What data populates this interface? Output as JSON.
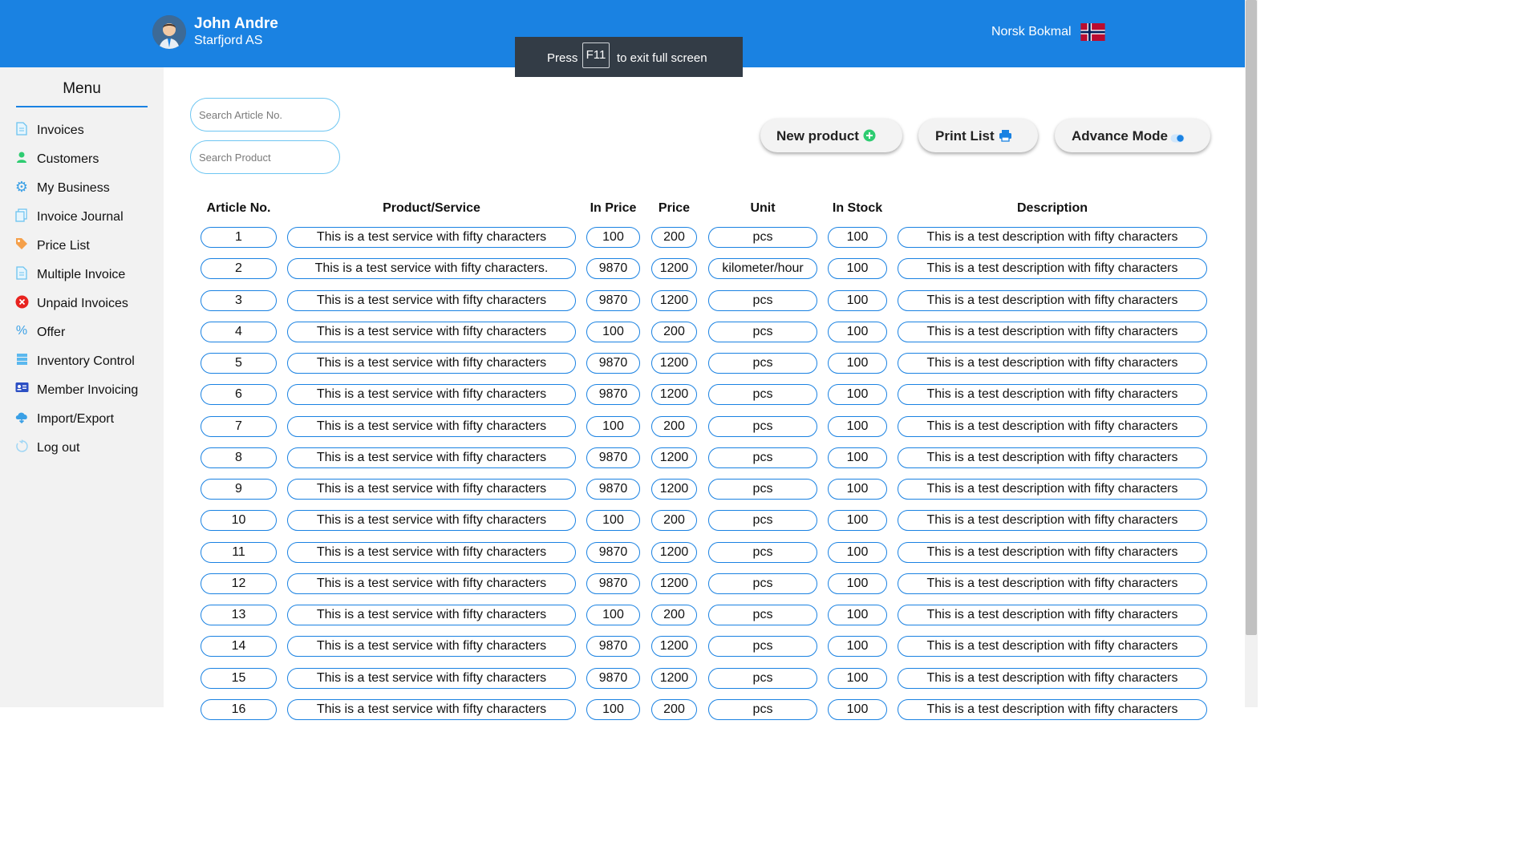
{
  "header": {
    "user_name": "John Andre",
    "company": "Starfjord AS",
    "language": "Norsk Bokmal",
    "background_color": "#1a82e2"
  },
  "fullscreen_toast": {
    "press": "Press",
    "key": "F11",
    "rest": "to exit full screen"
  },
  "sidebar": {
    "title": "Menu",
    "items": [
      {
        "label": "Invoices",
        "icon": "document-icon"
      },
      {
        "label": "Customers",
        "icon": "person-icon"
      },
      {
        "label": "My Business",
        "icon": "gear-icon"
      },
      {
        "label": "Invoice Journal",
        "icon": "copy-icon"
      },
      {
        "label": "Price List",
        "icon": "tag-icon"
      },
      {
        "label": "Multiple Invoice",
        "icon": "document-icon"
      },
      {
        "label": "Unpaid Invoices",
        "icon": "x-circle-icon"
      },
      {
        "label": "Offer",
        "icon": "percent-icon"
      },
      {
        "label": "Inventory Control",
        "icon": "list-icon"
      },
      {
        "label": "Member Invoicing",
        "icon": "id-card-icon"
      },
      {
        "label": "Import/Export",
        "icon": "cloud-icon"
      },
      {
        "label": "Log out",
        "icon": "logout-icon"
      }
    ]
  },
  "search": {
    "article_placeholder": "Search Article No.",
    "product_placeholder": "Search Product"
  },
  "actions": {
    "new_product": "New product",
    "print_list": "Print List",
    "advance_mode": "Advance Mode"
  },
  "table": {
    "columns": [
      "Article No.",
      "Product/Service",
      "In Price",
      "Price",
      "Unit",
      "In Stock",
      "Description"
    ],
    "rows": [
      [
        "1",
        "This is a test service with fifty characters",
        "100",
        "200",
        "pcs",
        "100",
        "This is a test description with fifty characters"
      ],
      [
        "2",
        "This is a test service with fifty characters.",
        "9870",
        "1200",
        "kilometer/hour",
        "100",
        "This is a test description with fifty characters"
      ],
      [
        "3",
        "This is a test service with fifty characters",
        "9870",
        "1200",
        "pcs",
        "100",
        "This is a test description with fifty characters"
      ],
      [
        "4",
        "This is a test service with fifty characters",
        "100",
        "200",
        "pcs",
        "100",
        "This is a test description with fifty characters"
      ],
      [
        "5",
        "This is a test service with fifty characters",
        "9870",
        "1200",
        "pcs",
        "100",
        "This is a test description with fifty characters"
      ],
      [
        "6",
        "This is a test service with fifty characters",
        "9870",
        "1200",
        "pcs",
        "100",
        "This is a test description with fifty characters"
      ],
      [
        "7",
        "This is a test service with fifty characters",
        "100",
        "200",
        "pcs",
        "100",
        "This is a test description with fifty characters"
      ],
      [
        "8",
        "This is a test service with fifty characters",
        "9870",
        "1200",
        "pcs",
        "100",
        "This is a test description with fifty characters"
      ],
      [
        "9",
        "This is a test service with fifty characters",
        "9870",
        "1200",
        "pcs",
        "100",
        "This is a test description with fifty characters"
      ],
      [
        "10",
        "This is a test service with fifty characters",
        "100",
        "200",
        "pcs",
        "100",
        "This is a test description with fifty characters"
      ],
      [
        "11",
        "This is a test service with fifty characters",
        "9870",
        "1200",
        "pcs",
        "100",
        "This is a test description with fifty characters"
      ],
      [
        "12",
        "This is a test service with fifty characters",
        "9870",
        "1200",
        "pcs",
        "100",
        "This is a test description with fifty characters"
      ],
      [
        "13",
        "This is a test service with fifty characters",
        "100",
        "200",
        "pcs",
        "100",
        "This is a test description with fifty characters"
      ],
      [
        "14",
        "This is a test service with fifty characters",
        "9870",
        "1200",
        "pcs",
        "100",
        "This is a test description with fifty characters"
      ],
      [
        "15",
        "This is a test service with fifty characters",
        "9870",
        "1200",
        "pcs",
        "100",
        "This is a test description with fifty characters"
      ],
      [
        "16",
        "This is a test service with fifty characters",
        "100",
        "200",
        "pcs",
        "100",
        "This is a test description with fifty characters"
      ]
    ]
  }
}
